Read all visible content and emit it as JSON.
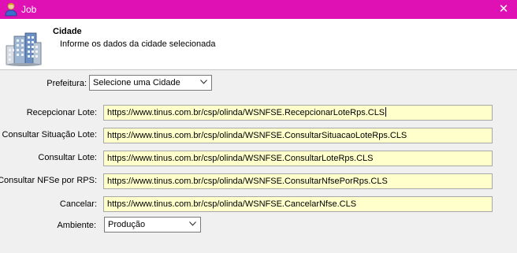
{
  "window": {
    "title": "Job",
    "close_glyph": "✕"
  },
  "header": {
    "title": "Cidade",
    "subtitle": "Informe os dados da cidade selecionada",
    "icon": "buildings-icon"
  },
  "form": {
    "prefeitura": {
      "label": "Prefeitura:",
      "selected": "Selecione uma Cidade"
    },
    "fields": [
      {
        "label": "Recepcionar Lote:",
        "value": "https://www.tinus.com.br/csp/olinda/WSNFSE.RecepcionarLoteRps.CLS"
      },
      {
        "label": "Consultar Situação Lote:",
        "value": "https://www.tinus.com.br/csp/olinda/WSNFSE.ConsultarSituacaoLoteRps.CLS"
      },
      {
        "label": "Consultar Lote:",
        "value": "https://www.tinus.com.br/csp/olinda/WSNFSE.ConsultarLoteRps.CLS"
      },
      {
        "label": "Consultar NFSe por RPS:",
        "value": "https://www.tinus.com.br/csp/olinda/WSNFSE.ConsultarNfsePorRps.CLS"
      },
      {
        "label": "Cancelar:",
        "value": "https://www.tinus.com.br/csp/olinda/WSNFSE.CancelarNfse.CLS"
      }
    ],
    "ambiente": {
      "label": "Ambiente:",
      "selected": "Produção"
    }
  },
  "colors": {
    "titlebar": "#e011b4",
    "field_background": "#ffffcc",
    "window_background": "#f0f0f0"
  }
}
